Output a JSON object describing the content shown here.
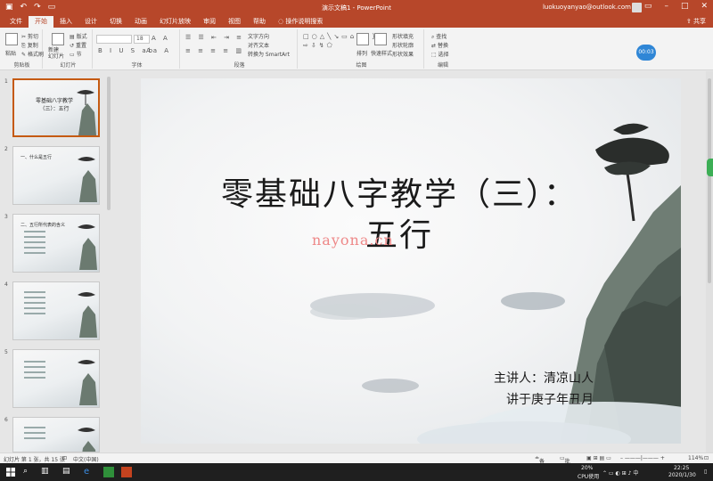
{
  "window": {
    "title": "演示文稿1 - PowerPoint",
    "user_email": "luokuoyanyao@outlook.com",
    "share_label": "共享"
  },
  "tabs": [
    "文件",
    "开始",
    "插入",
    "设计",
    "切换",
    "动画",
    "幻灯片放映",
    "审阅",
    "视图",
    "帮助",
    "操作说明搜索"
  ],
  "active_tab": "开始",
  "ribbon": {
    "clipboard": {
      "paste": "粘贴",
      "cut": "剪切",
      "copy": "复制",
      "format_painter": "格式刷",
      "label": "剪贴板"
    },
    "slides": {
      "new_slide": "新建\n幻灯片",
      "layout": "版式",
      "reset": "重置",
      "section": "节",
      "label": "幻灯片"
    },
    "font": {
      "size": "18",
      "label": "字体"
    },
    "paragraph": {
      "text_direction": "文字方向",
      "align_text": "对齐文本",
      "smartart": "转换为 SmartArt",
      "label": "段落"
    },
    "drawing": {
      "arrange": "排列",
      "quick_styles": "快速样式",
      "shape_fill": "形状填充",
      "shape_outline": "形状轮廓",
      "shape_effects": "形状效果",
      "label": "绘图"
    },
    "editing": {
      "find": "查找",
      "replace": "替换",
      "select": "选择",
      "label": "编辑"
    },
    "timer": "00:03"
  },
  "thumbnails": [
    {
      "num": "1",
      "title": "零基础八字教学（三）：五行",
      "active": true
    },
    {
      "num": "2",
      "title": "一、什么是五行",
      "active": false
    },
    {
      "num": "3",
      "title": "二、五行所代表的含义",
      "active": false
    },
    {
      "num": "4",
      "title": "",
      "active": false
    },
    {
      "num": "5",
      "title": "",
      "active": false
    },
    {
      "num": "6",
      "title": "",
      "active": false
    }
  ],
  "slide": {
    "title_line1": "零基础八字教学（三）：",
    "title_line2": "五行",
    "watermark": "nayona.cn",
    "presenter": "主讲人：清凉山人",
    "date": "讲于庚子年丑月"
  },
  "statusbar": {
    "slide_info": "幻灯片 第 1 张，共 15 张",
    "language": "中文(中国)",
    "notes": "备注",
    "comments": "批注",
    "zoom": "114%"
  },
  "taskbar": {
    "cpu": "20%",
    "cpu_label": "CPU使用",
    "time": "22:25",
    "date": "2020/1/30"
  }
}
